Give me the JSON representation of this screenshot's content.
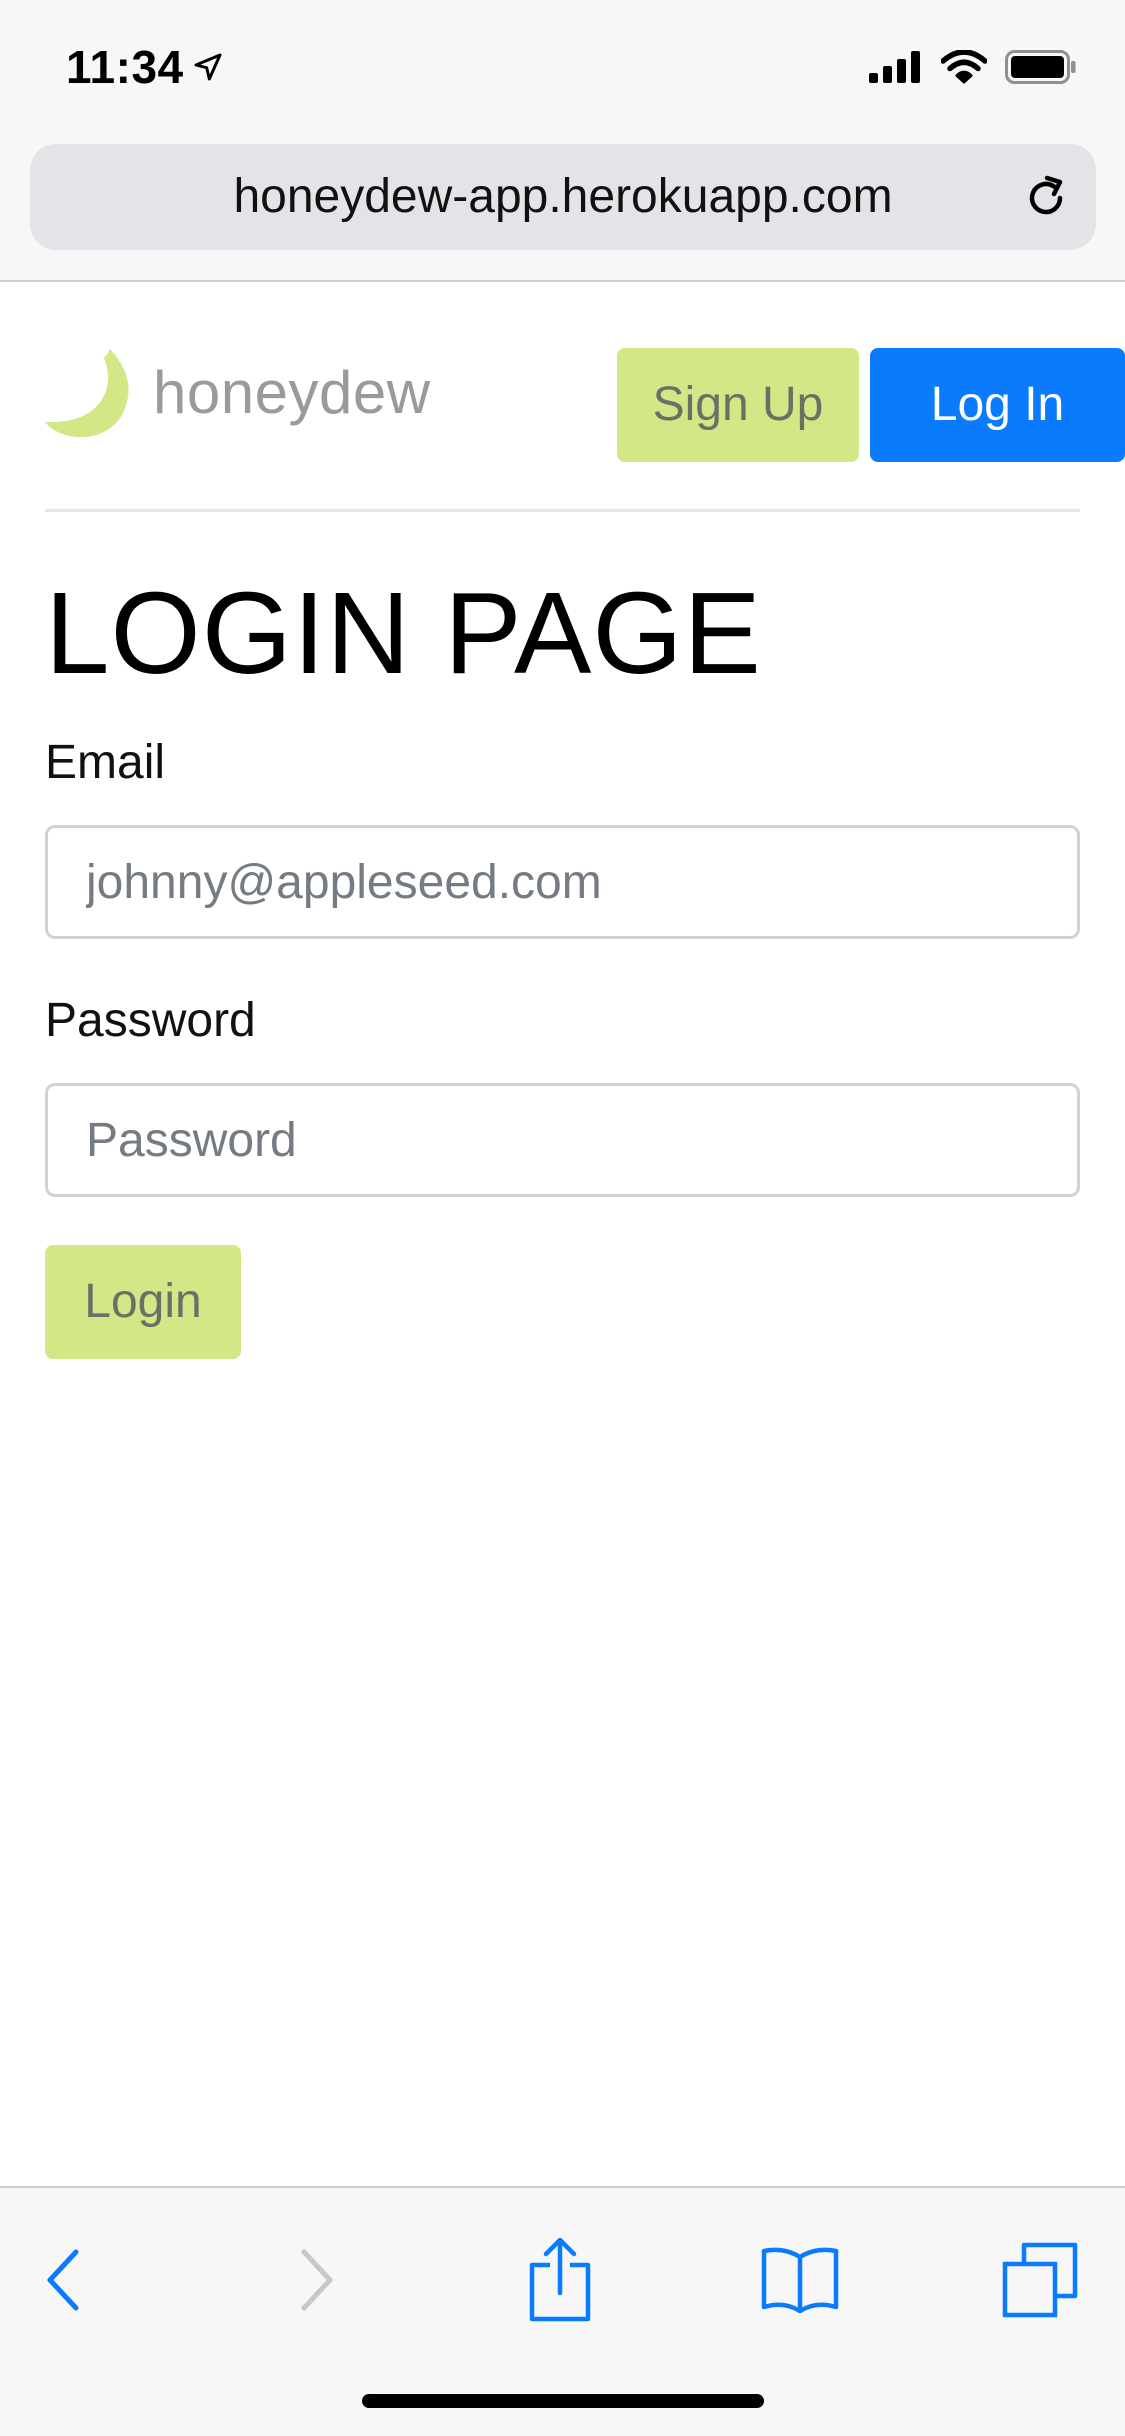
{
  "status_bar": {
    "time": "11:34",
    "location_icon": "location-arrow-icon",
    "signal_icon": "cellular-signal-icon",
    "wifi_icon": "wifi-icon",
    "battery_icon": "battery-icon"
  },
  "browser": {
    "url": "honeydew-app.herokuapp.com",
    "reload_icon": "reload-icon"
  },
  "header": {
    "logo_text": "honeydew",
    "logo_icon": "honeydew-melon-icon",
    "signup_label": "Sign Up",
    "login_label": "Log In"
  },
  "main": {
    "title": "LOGIN PAGE",
    "email_label": "Email",
    "email_placeholder": "johnny@appleseed.com",
    "password_label": "Password",
    "password_placeholder": "Password",
    "submit_label": "Login"
  },
  "toolbar": {
    "back_icon": "chevron-left-icon",
    "forward_icon": "chevron-right-icon",
    "share_icon": "share-icon",
    "bookmarks_icon": "book-icon",
    "tabs_icon": "tabs-icon"
  },
  "colors": {
    "brand_green": "#d2e785",
    "primary_blue": "#0a7bfd",
    "ios_tint": "#0a7bfd",
    "disabled_gray": "#c7c7cc"
  }
}
